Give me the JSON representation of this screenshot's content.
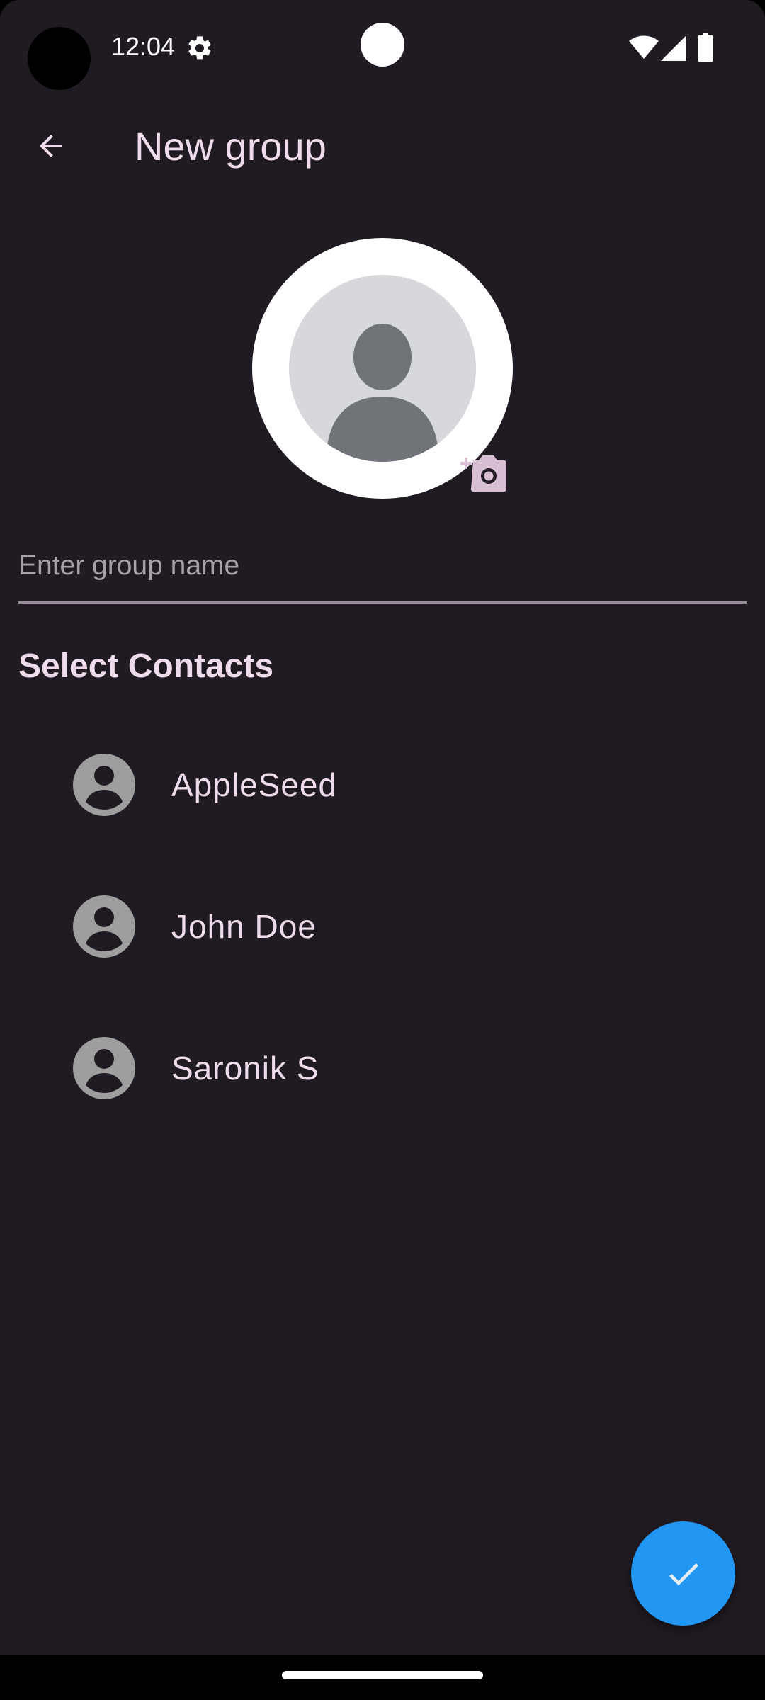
{
  "status_bar": {
    "time": "12:04",
    "icons": [
      "gear-icon",
      "wifi-icon",
      "signal-icon",
      "battery-icon"
    ]
  },
  "app_bar": {
    "back_icon": "arrow-left-icon",
    "title": "New group"
  },
  "group_avatar": {
    "placeholder_icon": "person-silhouette-icon",
    "add_photo_icon": "add-camera-icon"
  },
  "group_name": {
    "placeholder": "Enter group name",
    "value": ""
  },
  "contacts": {
    "title": "Select Contacts",
    "items": [
      {
        "name": "AppleSeed",
        "icon": "account-circle-icon"
      },
      {
        "name": "John Doe",
        "icon": "account-circle-icon"
      },
      {
        "name": "Saronik S",
        "icon": "account-circle-icon"
      }
    ]
  },
  "fab": {
    "icon": "check-icon"
  },
  "colors": {
    "background": "#201b22",
    "text_primary": "#efdcea",
    "fab": "#2196f3",
    "avatar_grey": "#9e9e9e"
  }
}
